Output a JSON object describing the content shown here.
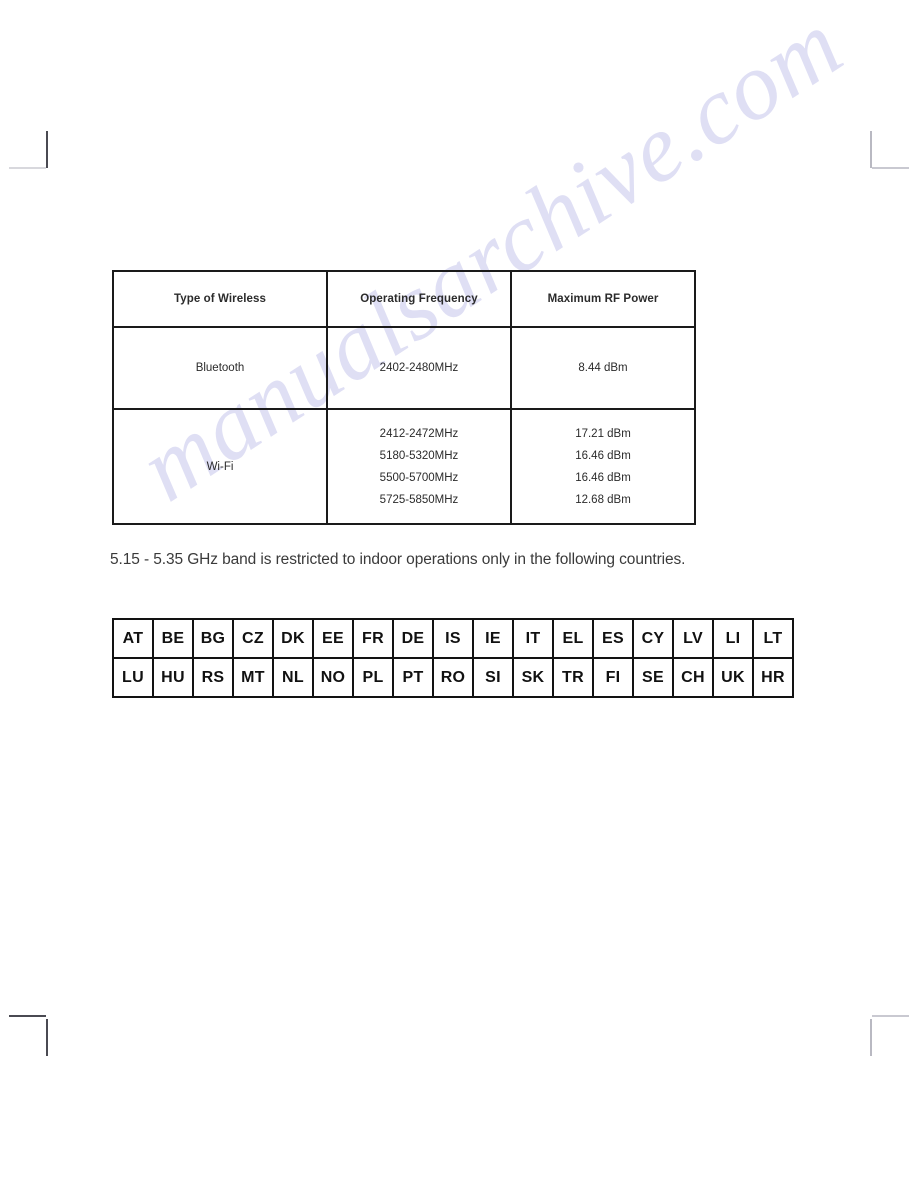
{
  "watermark": {
    "text": "manualsarchive.com"
  },
  "rf_table": {
    "headers": [
      "Type of Wireless",
      "Operating Frequency",
      "Maximum RF Power"
    ],
    "rows": [
      {
        "type": "Bluetooth",
        "frequencies": [
          "2402-2480MHz"
        ],
        "powers": [
          "8.44 dBm"
        ]
      },
      {
        "type": "Wi-Fi",
        "frequencies": [
          "2412-2472MHz",
          "5180-5320MHz",
          "5500-5700MHz",
          "5725-5850MHz"
        ],
        "powers": [
          "17.21 dBm",
          "16.46 dBm",
          "16.46 dBm",
          "12.68 dBm"
        ]
      }
    ]
  },
  "note": {
    "text": "5.15 - 5.35 GHz band is restricted to indoor operations only in the following countries."
  },
  "country_table": {
    "rows": [
      [
        "AT",
        "BE",
        "BG",
        "CZ",
        "DK",
        "EE",
        "FR",
        "DE",
        "IS",
        "IE",
        "IT",
        "EL",
        "ES",
        "CY",
        "LV",
        "LI",
        "LT"
      ],
      [
        "LU",
        "HU",
        "RS",
        "MT",
        "NL",
        "NO",
        "PL",
        "PT",
        "RO",
        "SI",
        "SK",
        "TR",
        "FI",
        "SE",
        "CH",
        "UK",
        "HR"
      ]
    ]
  }
}
